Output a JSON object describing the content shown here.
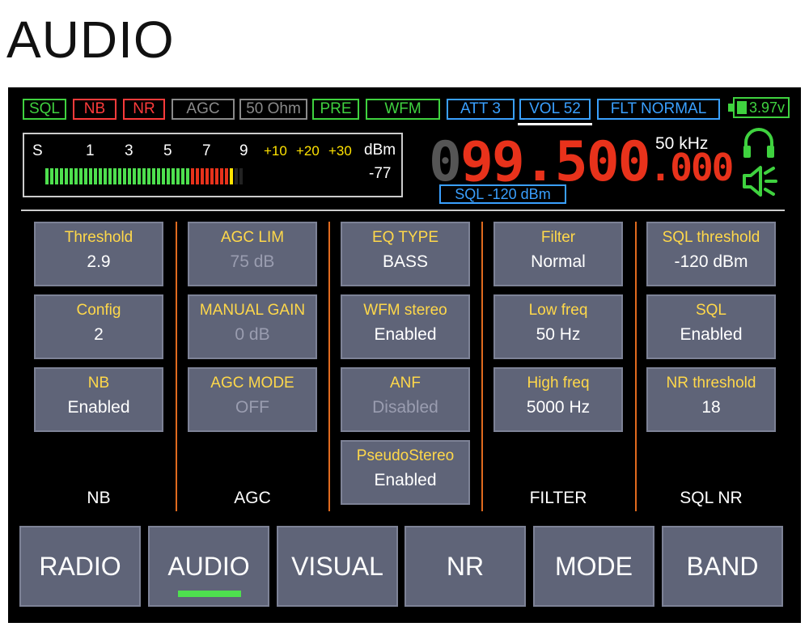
{
  "page_title": "AUDIO",
  "status_tags": [
    {
      "label": "SQL",
      "color": "#3fd23f"
    },
    {
      "label": "NB",
      "color": "#ff3b3b"
    },
    {
      "label": "NR",
      "color": "#ff3b3b"
    },
    {
      "label": "AGC",
      "color": "#8a8a8a"
    },
    {
      "label": "50 Ohm",
      "color": "#8a8a8a"
    },
    {
      "label": "PRE",
      "color": "#3fd23f"
    },
    {
      "label": "WFM",
      "color": "#3fd23f"
    },
    {
      "label": "ATT 3",
      "color": "#3aa0ff"
    },
    {
      "label": "VOL 52",
      "color": "#3aa0ff"
    },
    {
      "label": "FLT NORMAL",
      "color": "#3aa0ff"
    }
  ],
  "battery": "3.97v",
  "smeter": {
    "scale": [
      "S",
      "1",
      "3",
      "5",
      "7",
      "9",
      "+10",
      "+20",
      "+30"
    ],
    "unit": "dBm",
    "value": "-77",
    "bars_green": 30,
    "bars_red": 8,
    "bars_yellow": 1,
    "bars_empty": 2
  },
  "frequency": {
    "ghost_digit": "0",
    "main": "99.500",
    "sub": ".000"
  },
  "step": "50 kHz",
  "sql_level": "SQL -120 dBm",
  "groups": [
    {
      "name": "NB",
      "params": [
        {
          "label": "Threshold",
          "value": "2.9",
          "disabled": false
        },
        {
          "label": "Config",
          "value": "2",
          "disabled": false
        },
        {
          "label": "NB",
          "value": "Enabled",
          "disabled": false
        }
      ]
    },
    {
      "name": "AGC",
      "params": [
        {
          "label": "AGC LIM",
          "value": "75 dB",
          "disabled": true
        },
        {
          "label": "MANUAL GAIN",
          "value": "0 dB",
          "disabled": true
        },
        {
          "label": "AGC MODE",
          "value": "OFF",
          "disabled": true
        }
      ]
    },
    {
      "name": "",
      "params": [
        {
          "label": "EQ TYPE",
          "value": "BASS",
          "disabled": false
        },
        {
          "label": "WFM stereo",
          "value": "Enabled",
          "disabled": false
        },
        {
          "label": "ANF",
          "value": "Disabled",
          "disabled": true
        },
        {
          "label": "PseudoStereo",
          "value": "Enabled",
          "disabled": false
        }
      ]
    },
    {
      "name": "FILTER",
      "params": [
        {
          "label": "Filter",
          "value": "Normal",
          "disabled": false
        },
        {
          "label": "Low freq",
          "value": "50 Hz",
          "disabled": false
        },
        {
          "label": "High freq",
          "value": "5000 Hz",
          "disabled": false
        }
      ]
    },
    {
      "name": "SQL NR",
      "params": [
        {
          "label": "SQL threshold",
          "value": "-120 dBm",
          "disabled": false
        },
        {
          "label": "SQL",
          "value": "Enabled",
          "disabled": false
        },
        {
          "label": "NR threshold",
          "value": "18",
          "disabled": false
        }
      ]
    }
  ],
  "nav_tabs": [
    {
      "label": "RADIO",
      "active": false
    },
    {
      "label": "AUDIO",
      "active": true
    },
    {
      "label": "VISUAL",
      "active": false
    },
    {
      "label": "NR",
      "active": false
    },
    {
      "label": "MODE",
      "active": false
    },
    {
      "label": "BAND",
      "active": false
    }
  ],
  "colors": {
    "accent_green": "#3fd23f",
    "accent_blue": "#3aa0ff",
    "accent_red": "#ff3b3b",
    "param_label": "#ffd84a",
    "frequency": "#e8321b",
    "separator": "#e06a1e"
  }
}
